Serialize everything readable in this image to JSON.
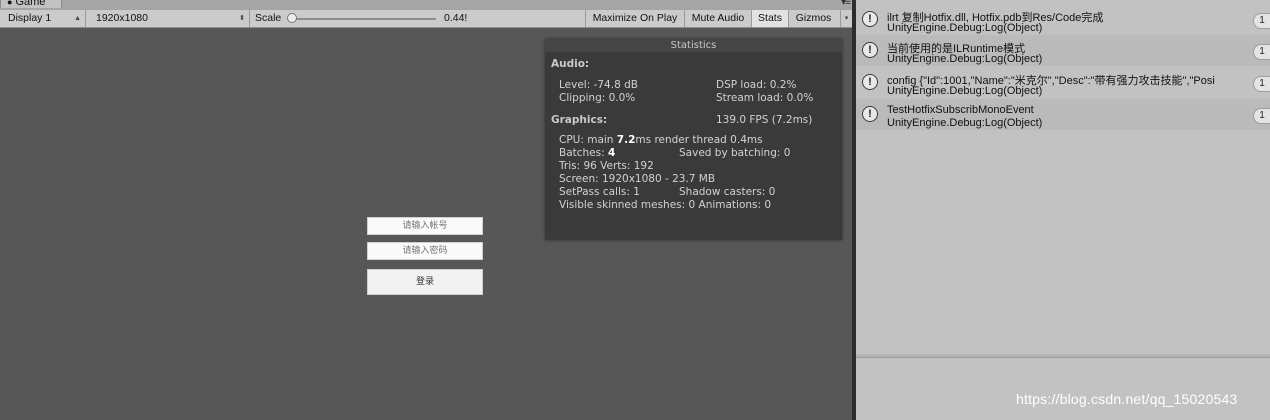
{
  "game": {
    "tab_label": "Game",
    "toolbar": {
      "display": "Display 1",
      "resolution": "1920x1080",
      "scale_label": "Scale",
      "scale_value": "0.44!",
      "scale_level": 0.0,
      "maximize_on_play": "Maximize On Play",
      "mute_audio": "Mute Audio",
      "stats": "Stats",
      "gizmos": "Gizmos"
    },
    "login": {
      "account_placeholder": "请输入帐号",
      "password_placeholder": "请输入密码",
      "login_button": "登录"
    },
    "stats": {
      "title": "Statistics",
      "audio_header": "Audio:",
      "level": "Level: -74.8 dB",
      "clipping": "Clipping: 0.0%",
      "dsp_load": "DSP load: 0.2%",
      "stream_load": "Stream load: 0.0%",
      "graphics_header": "Graphics:",
      "fps": "139.0 FPS (7.2ms)",
      "cpu_prefix": "CPU: main ",
      "cpu_main": "7.2",
      "cpu_suffix": "ms  render thread 0.4ms",
      "batches_prefix": "Batches: ",
      "batches": "4",
      "saved_by_batching": "Saved by batching: 0",
      "tris_verts": "Tris: 96   Verts: 192",
      "screen": "Screen: 1920x1080 - 23.7 MB",
      "setpass": "SetPass calls: 1",
      "shadow_casters": "Shadow casters: 0",
      "skinned_animations": "Visible skinned meshes: 0  Animations: 0"
    }
  },
  "console": {
    "entries": [
      {
        "line1": "ilrt 复制Hotfix.dll, Hotfix.pdb到Res/Code完成",
        "line2": "UnityEngine.Debug:Log(Object)",
        "count": "1"
      },
      {
        "line1": "当前使用的是ILRuntime模式",
        "line2": "UnityEngine.Debug:Log(Object)",
        "count": "1"
      },
      {
        "line1": "config {\"Id\":1001,\"Name\":\"米克尔\",\"Desc\":\"带有强力攻击技能\",\"Posi",
        "line2": "UnityEngine.Debug:Log(Object)",
        "count": "1"
      },
      {
        "line1": "TestHotfixSubscribMonoEvent",
        "line2": "UnityEngine.Debug:Log(Object)",
        "count": "1"
      }
    ]
  },
  "watermark": "https://blog.csdn.net/qq_15020543"
}
